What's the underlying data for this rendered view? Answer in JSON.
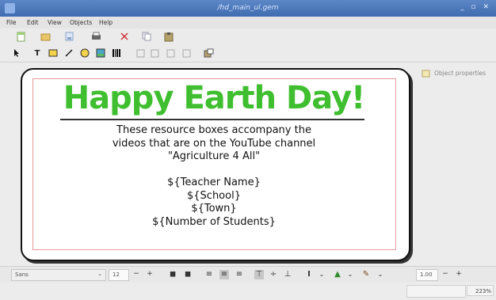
{
  "window": {
    "title": "/hd_main_ul.gem"
  },
  "menu": {
    "file": "File",
    "edit": "Edit",
    "view": "View",
    "objects": "Objects",
    "help": "Help"
  },
  "side_panel": {
    "label": "Object properties"
  },
  "card": {
    "headline": "Happy Earth Day!",
    "lines": [
      "These resource boxes accompany the",
      "videos that are on the YouTube channel",
      "\"Agriculture 4 All\"",
      "",
      "${Teacher Name}",
      "${School}",
      "${Town}",
      "${Number of Students}"
    ]
  },
  "bottom_toolbar": {
    "font_family": "Sans",
    "font_size": "12",
    "minus": "−",
    "plus": "+",
    "line_width": "1.00"
  },
  "status": {
    "zoom": "223%"
  },
  "colors": {
    "headline": "#3fbf2f",
    "titlebar": "#4a77bb",
    "margin_line": "#e79a9a"
  }
}
